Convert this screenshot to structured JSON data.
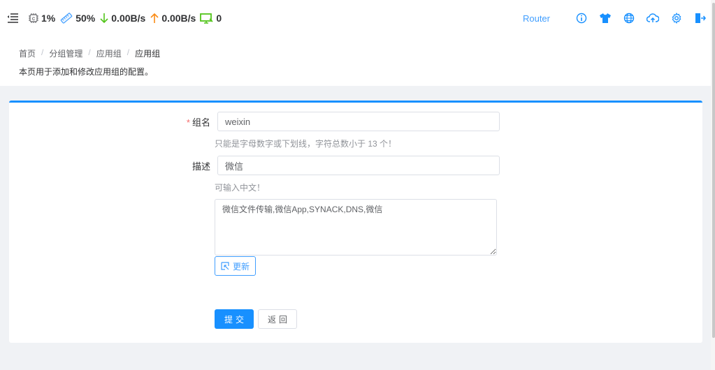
{
  "topbar": {
    "cpu_value": "1%",
    "mem_value": "50%",
    "down_speed": "0.00B/s",
    "up_speed": "0.00B/s",
    "devices_count": "0",
    "router_label": "Router",
    "icons": [
      "info-icon",
      "theme-shirt-icon",
      "globe-icon",
      "cloud-upload-icon",
      "settings-icon",
      "logout-icon"
    ]
  },
  "breadcrumb": {
    "items": [
      "首页",
      "分组管理",
      "应用组",
      "应用组"
    ],
    "separator": "/"
  },
  "page_description": "本页用于添加和修改应用组的配置。",
  "form": {
    "group_name": {
      "label": "组名",
      "required_mark": "*",
      "value": "weixin",
      "hint": "只能是字母数字或下划线，字符总数小于 13 个！"
    },
    "description": {
      "label": "描述",
      "value": "微信",
      "hint": "可输入中文！"
    },
    "apps_textarea": {
      "value": "微信文件传输,微信App,SYNACK,DNS,微信"
    },
    "update_button": "更新",
    "submit_button": "提交",
    "back_button": "返回"
  },
  "colors": {
    "accent": "#1890ff",
    "link": "#409eff",
    "required": "#f56c6c",
    "down_arrow": "#52c41a",
    "up_arrow": "#fa8c16",
    "monitor": "#52c41a"
  }
}
